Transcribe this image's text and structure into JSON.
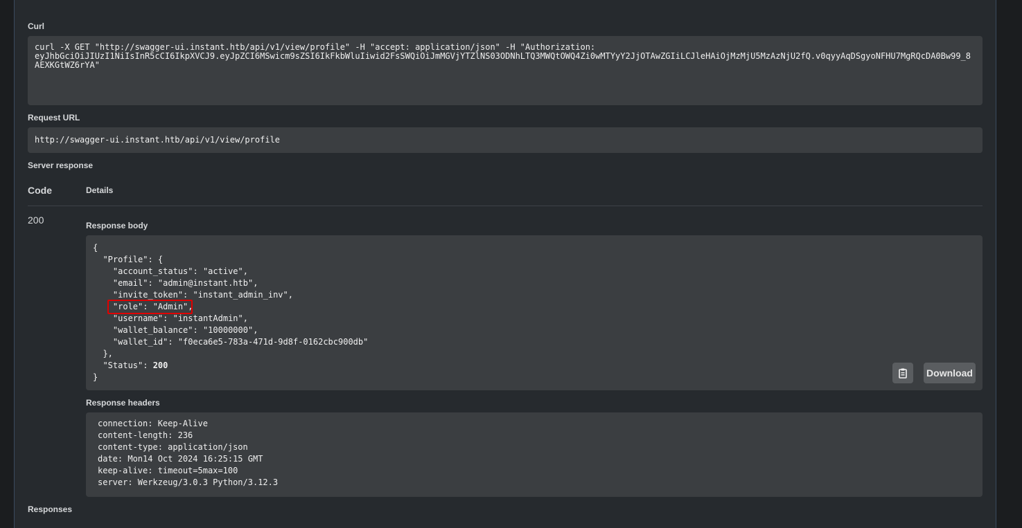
{
  "curl": {
    "label": "Curl",
    "command": "curl -X GET \"http://swagger-ui.instant.htb/api/v1/view/profile\" -H \"accept: application/json\" -H \"Authorization: \neyJhbGciOiJIUzI1NiIsInR5cCI6IkpXVCJ9.eyJpZCI6MSwicm9sZSI6IkFkbWluIiwid2FsSWQiOiJmMGVjYTZlNS03ODNhLTQ3MWQtOWQ4Zi0wMTYyY2JjOTAwZGIiLCJleHAiOjMzMjU5MzAzNjU2fQ.v0qyyAqDSgyoNFHU7MgRQcDA0Bw99_8AEXKGtWZ6rYA\""
  },
  "request_url": {
    "label": "Request URL",
    "value": "http://swagger-ui.instant.htb/api/v1/view/profile"
  },
  "server_response": {
    "label": "Server response",
    "code_header": "Code",
    "details_header": "Details",
    "code": "200",
    "body_label": "Response body",
    "body_lines": {
      "l1": "{",
      "l2": "  \"Profile\": {",
      "l3": "    \"account_status\": \"active\",",
      "l4": "    \"email\": \"admin@instant.htb\",",
      "l5": "    \"invite_token\": \"instant_admin_inv\",",
      "l6": "    \"role\": \"Admin\",",
      "l7": "    \"username\": \"instantAdmin\",",
      "l8": "    \"wallet_balance\": \"10000000\",",
      "l9": "    \"wallet_id\": \"f0eca6e5-783a-471d-9d8f-0162cbc900db\"",
      "l10": "  },",
      "l11a": "  \"Status\": ",
      "l11b": "200",
      "l12": "}"
    },
    "download_label": "Download",
    "copy_icon": "clipboard-icon",
    "headers_label": "Response headers",
    "headers": [
      "connection: Keep-Alive",
      "content-length: 236",
      "content-type: application/json",
      "date: Mon14 Oct 2024 16:25:15 GMT",
      "keep-alive: timeout=5max=100",
      "server: Werkzeug/3.0.3 Python/3.12.3"
    ]
  },
  "responses_label": "Responses",
  "colors": {
    "highlight": "#e00000",
    "code_bg": "#3b3e41",
    "panel_bg": "#262a2e"
  }
}
